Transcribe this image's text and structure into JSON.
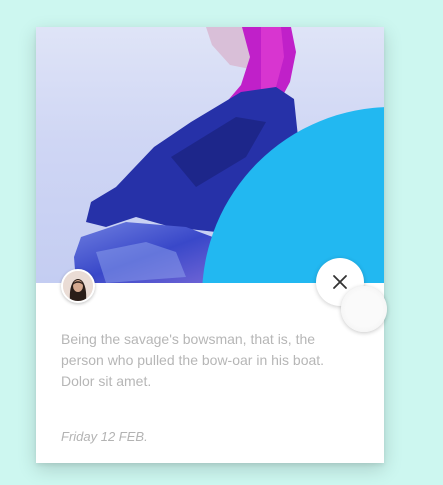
{
  "card": {
    "body_text": "Being the savage's bowsman, that is, the person who pulled the bow-oar in his boat. Dolor sit amet.",
    "date": "Friday 12 FEB."
  },
  "icons": {
    "close": "close-icon",
    "avatar": "avatar"
  },
  "colors": {
    "background": "#cdf7f0",
    "accent_circle": "#22b8f1",
    "hair": "#c020c9",
    "jacket": "#2631a8"
  }
}
